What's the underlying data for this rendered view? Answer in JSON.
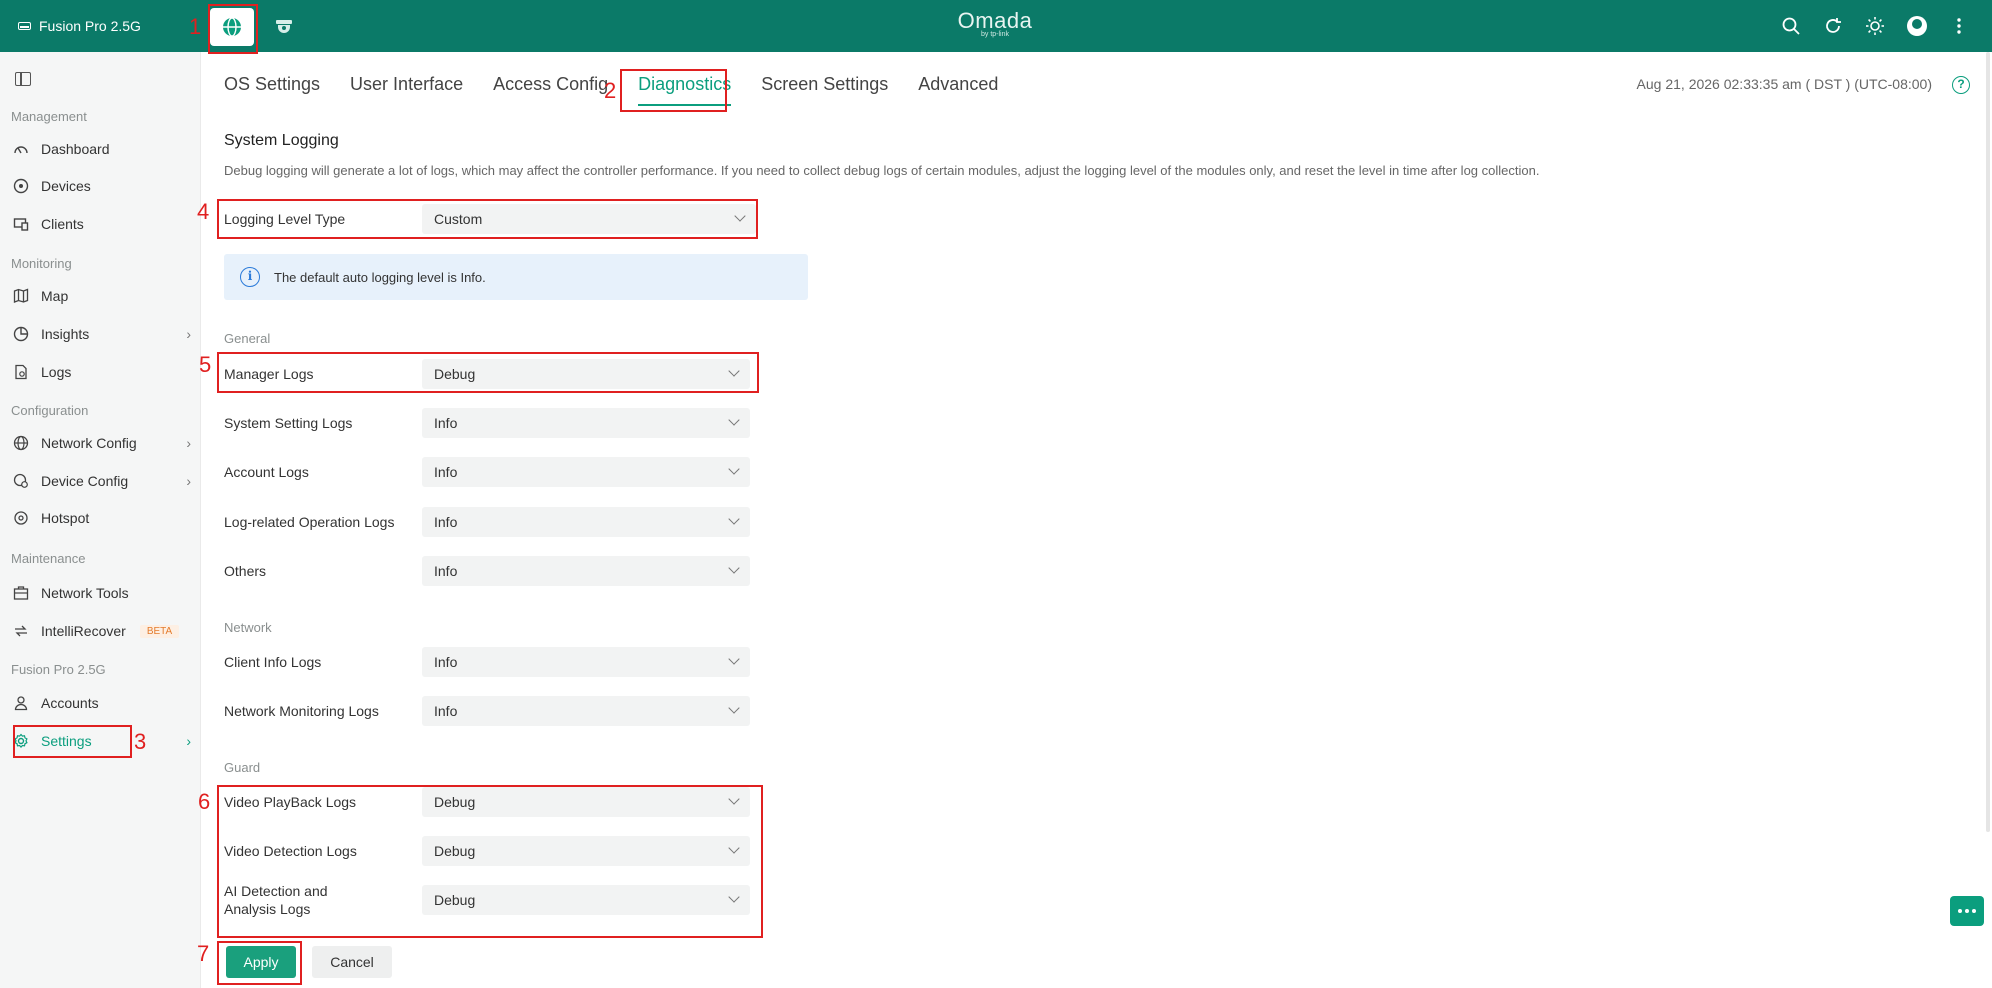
{
  "topbar": {
    "site_name": "Fusion Pro 2.5G",
    "brand": "Omada",
    "brand_sub": "by tp-link"
  },
  "sidebar": {
    "sections": [
      {
        "title": "Management",
        "items": [
          {
            "label": "Dashboard",
            "icon": "dashboard-icon"
          },
          {
            "label": "Devices",
            "icon": "devices-icon"
          },
          {
            "label": "Clients",
            "icon": "clients-icon"
          }
        ]
      },
      {
        "title": "Monitoring",
        "items": [
          {
            "label": "Map",
            "icon": "map-icon"
          },
          {
            "label": "Insights",
            "icon": "insights-icon"
          },
          {
            "label": "Logs",
            "icon": "logs-icon"
          }
        ]
      },
      {
        "title": "Configuration",
        "items": [
          {
            "label": "Network Config",
            "icon": "network-config-icon"
          },
          {
            "label": "Device Config",
            "icon": "device-config-icon"
          },
          {
            "label": "Hotspot",
            "icon": "hotspot-icon"
          }
        ]
      },
      {
        "title": "Maintenance",
        "items": [
          {
            "label": "Network Tools",
            "icon": "network-tools-icon"
          },
          {
            "label": "IntelliRecover",
            "icon": "intellirecover-icon",
            "badge": "BETA"
          }
        ]
      },
      {
        "title": "Fusion Pro 2.5G",
        "items": [
          {
            "label": "Accounts",
            "icon": "accounts-icon"
          },
          {
            "label": "Settings",
            "icon": "settings-icon"
          }
        ]
      }
    ]
  },
  "tabs": [
    "OS Settings",
    "User Interface",
    "Access Config",
    "Diagnostics",
    "Screen Settings",
    "Advanced"
  ],
  "active_tab": "Diagnostics",
  "datetime": "Aug 21, 2026 02:33:35 am ( DST ) (UTC-08:00)",
  "page": {
    "title": "System Logging",
    "description": "Debug logging will generate a lot of logs, which may affect the controller performance. If you need to collect debug logs of certain modules, adjust the logging level of the modules only, and reset the level in time after log collection.",
    "logging_level_type": {
      "label": "Logging Level Type",
      "value": "Custom"
    },
    "info": "The default auto logging level is Info.",
    "groups": {
      "general": {
        "title": "General",
        "rows": [
          {
            "label": "Manager Logs",
            "value": "Debug"
          },
          {
            "label": "System Setting Logs",
            "value": "Info"
          },
          {
            "label": "Account Logs",
            "value": "Info"
          },
          {
            "label": "Log-related Operation Logs",
            "value": "Info"
          },
          {
            "label": "Others",
            "value": "Info"
          }
        ]
      },
      "network": {
        "title": "Network",
        "rows": [
          {
            "label": "Client Info Logs",
            "value": "Info"
          },
          {
            "label": "Network Monitoring Logs",
            "value": "Info"
          }
        ]
      },
      "guard": {
        "title": "Guard",
        "rows": [
          {
            "label": "Video PlayBack Logs",
            "value": "Debug"
          },
          {
            "label": "Video Detection Logs",
            "value": "Debug"
          },
          {
            "label": "AI Detection and Analysis Logs",
            "value": "Debug"
          }
        ]
      }
    },
    "apply_label": "Apply",
    "cancel_label": "Cancel"
  },
  "annotations": [
    "1",
    "2",
    "3",
    "4",
    "5",
    "6",
    "7"
  ],
  "colors": {
    "topbar": "#0b7a68",
    "accent": "#0b9e7e",
    "apply": "#1aa07d",
    "annotation": "#e02020",
    "info_bg": "#e7f1fb"
  }
}
